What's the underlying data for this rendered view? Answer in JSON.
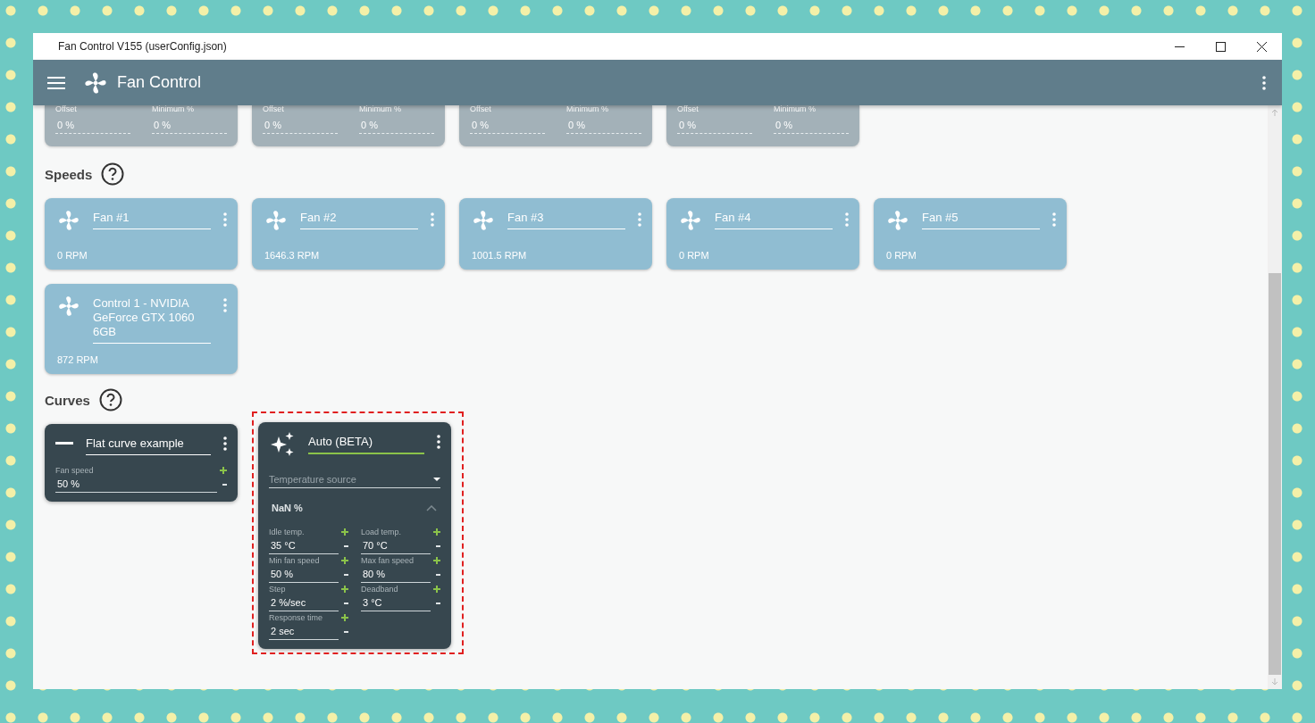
{
  "window": {
    "title": "Fan Control V155 (userConfig.json)"
  },
  "app_bar": {
    "title": "Fan Control"
  },
  "controls_cut": [
    {
      "fields": [
        {
          "label": "Offset",
          "value": "0 %"
        },
        {
          "label": "Minimum %",
          "value": "0 %"
        }
      ]
    },
    {
      "fields": [
        {
          "label": "Offset",
          "value": "0 %"
        },
        {
          "label": "Minimum %",
          "value": "0 %"
        }
      ]
    },
    {
      "fields": [
        {
          "label": "Offset",
          "value": "0 %"
        },
        {
          "label": "Minimum %",
          "value": "0 %"
        }
      ]
    },
    {
      "fields": [
        {
          "label": "Offset",
          "value": "0 %"
        },
        {
          "label": "Minimum %",
          "value": "0 %"
        }
      ]
    }
  ],
  "speeds": {
    "title": "Speeds",
    "cards": [
      {
        "name": "Fan #1",
        "reading": "0 RPM"
      },
      {
        "name": "Fan #2",
        "reading": "1646.3 RPM"
      },
      {
        "name": "Fan #3",
        "reading": "1001.5 RPM"
      },
      {
        "name": "Fan #4",
        "reading": "0 RPM"
      },
      {
        "name": "Fan #5",
        "reading": "0 RPM"
      },
      {
        "name": "Control 1 - NVIDIA GeForce GTX 1060 6GB",
        "reading": "872 RPM"
      }
    ]
  },
  "curves": {
    "title": "Curves",
    "cards": [
      {
        "kind": "flat",
        "name": "Flat curve example",
        "focused": false,
        "fields": [
          {
            "label": "Fan speed",
            "value": "50 %"
          }
        ]
      },
      {
        "kind": "auto",
        "name": "Auto (BETA)",
        "focused": true,
        "highlighted": true,
        "source_placeholder": "Temperature source",
        "output": "NaN %",
        "expanded": true,
        "fields": [
          {
            "label": "Idle temp.",
            "value": "35 °C"
          },
          {
            "label": "Load temp.",
            "value": "70 °C"
          },
          {
            "label": "Min fan speed",
            "value": "50 %"
          },
          {
            "label": "Max fan speed",
            "value": "80 %"
          },
          {
            "label": "Step",
            "value": "2 %/sec"
          },
          {
            "label": "Deadband",
            "value": "3 °C"
          },
          {
            "label": "Response time",
            "value": "2 sec"
          }
        ]
      }
    ]
  }
}
